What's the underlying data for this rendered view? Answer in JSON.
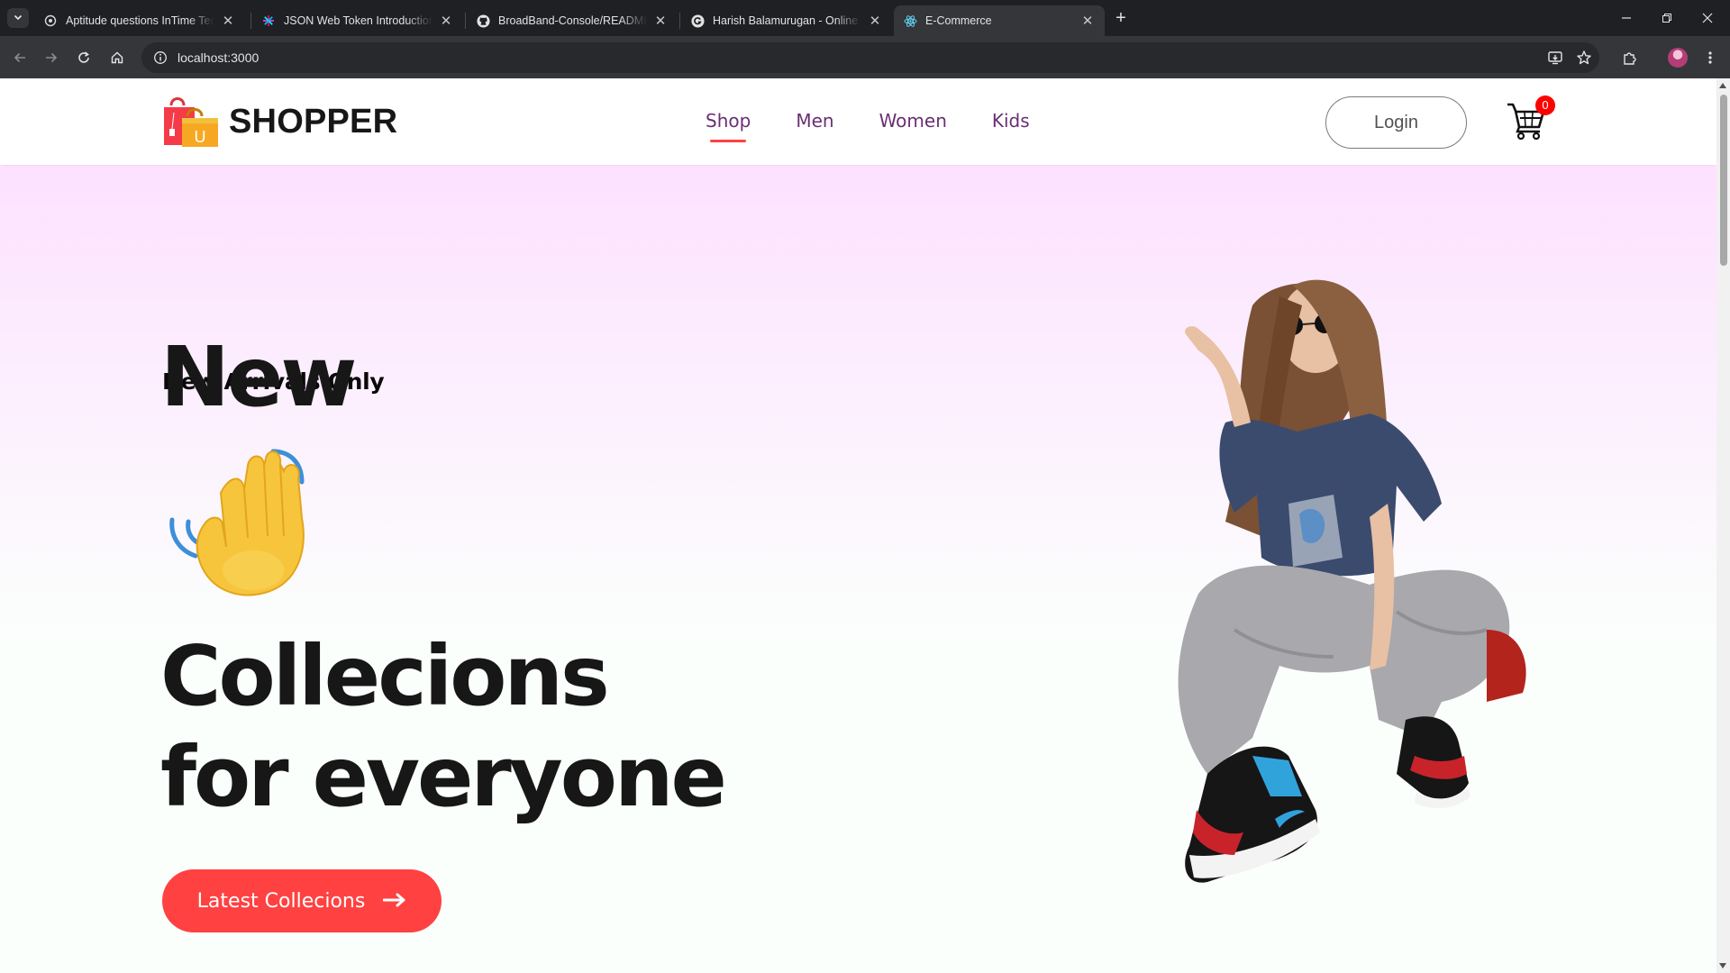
{
  "browser": {
    "tabs": [
      {
        "title": "Aptitude questions InTime Tec",
        "favicon": "openai-icon"
      },
      {
        "title": "JSON Web Token Introduction -",
        "favicon": "jwt-icon"
      },
      {
        "title": "BroadBand-Console/README.m",
        "favicon": "github-icon"
      },
      {
        "title": "Harish Balamurugan - Online Le",
        "favicon": "grammarly-icon"
      },
      {
        "title": "E-Commerce",
        "favicon": "react-icon",
        "active": true
      }
    ],
    "url": "localhost:3000"
  },
  "navbar": {
    "brand": "SHOPPER",
    "logo_letter": "U",
    "menu": [
      "Shop",
      "Men",
      "Women",
      "Kids"
    ],
    "active_menu": "Shop",
    "login_label": "Login",
    "cart_count": "0"
  },
  "hero": {
    "subtitle": "New Arrivals Only",
    "line1": "New",
    "line2": "Collecions",
    "line3": "for everyone",
    "button_label": "Latest Collecions",
    "button_icon": "arrow-right-icon",
    "emoji": "waving-hand-icon"
  },
  "colors": {
    "accent": "#ff4141",
    "menu_active": "#6a2f74",
    "hero_gradient_top": "#fde1ff",
    "hero_gradient_bottom": "#e1ffea"
  }
}
